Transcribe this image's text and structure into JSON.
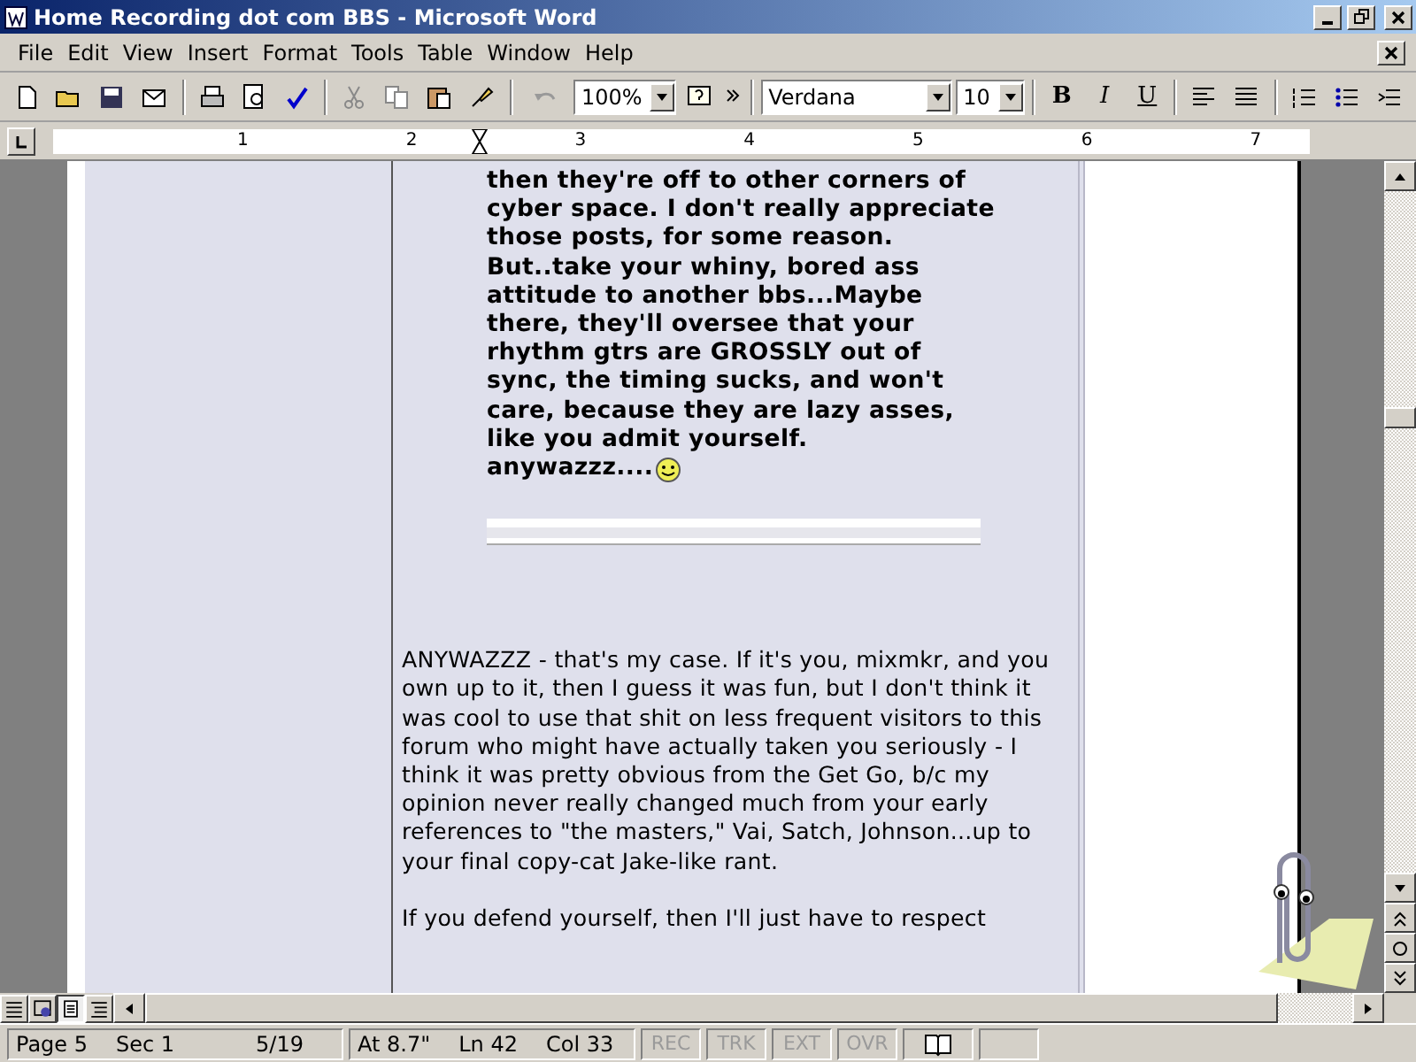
{
  "window": {
    "title": "Home Recording dot com BBS - Microsoft Word"
  },
  "menu": [
    "File",
    "Edit",
    "View",
    "Insert",
    "Format",
    "Tools",
    "Table",
    "Window",
    "Help"
  ],
  "toolbar": {
    "zoom": "100%",
    "font": "Verdana",
    "size": "10",
    "format_buttons": [
      "B",
      "I",
      "U"
    ]
  },
  "ruler": {
    "numbers": [
      "1",
      "2",
      "3",
      "4",
      "5",
      "6",
      "7"
    ]
  },
  "document": {
    "quote_lines": [
      "then they're off to other corners of",
      "cyber space. I don't really appreciate",
      "those posts, for some reason.",
      "But..take your whiny, bored ass",
      "attitude to another bbs...Maybe",
      "there, they'll oversee that your",
      "rhythm gtrs are GROSSLY out of",
      "sync, the timing sucks, and won't",
      "care, because they are lazy asses,",
      "like you admit yourself.",
      "anywazzz...."
    ],
    "paragraphs": [
      "ANYWAZZZ - that's my case. If it's you, mixmkr, and you own up to it, then I guess it was fun, but I don't think it was cool to use that shit on less frequent visitors to this forum who might have actually taken you seriously - I think it was pretty obvious from the Get Go, b/c my opinion never really changed much from your early references to \"the masters,\" Vai, Satch, Johnson...up to your final copy-cat Jake-like rant.",
      "If you defend yourself, then I'll just have to respect"
    ]
  },
  "view_buttons": [
    {
      "kind": "normal",
      "selected": false
    },
    {
      "kind": "web",
      "selected": false
    },
    {
      "kind": "print",
      "selected": true
    },
    {
      "kind": "outline",
      "selected": false
    }
  ],
  "status_bar": {
    "fields": [
      "Page 5",
      "Sec 1",
      "5/19",
      "At 8.7\"",
      "Ln 42",
      "Col 33"
    ],
    "modes": [
      {
        "label": "REC",
        "on": false
      },
      {
        "label": "TRK",
        "on": false
      },
      {
        "label": "EXT",
        "on": false
      },
      {
        "label": "OVR",
        "on": false
      }
    ]
  }
}
